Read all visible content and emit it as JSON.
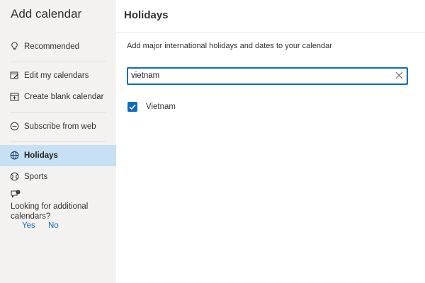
{
  "sidebar": {
    "title": "Add calendar",
    "items": [
      {
        "label": "Recommended",
        "icon": "lightbulb-icon"
      },
      {
        "label": "Edit my calendars",
        "icon": "edit-calendar-icon"
      },
      {
        "label": "Create blank calendar",
        "icon": "add-calendar-icon"
      },
      {
        "label": "Subscribe from web",
        "icon": "link-icon"
      },
      {
        "label": "Holidays",
        "icon": "globe-icon"
      },
      {
        "label": "Sports",
        "icon": "sports-icon"
      }
    ],
    "active_item": "Holidays",
    "feedback": {
      "icon": "feedback-icon",
      "question": "Looking for additional calendars?",
      "yes": "Yes",
      "no": "No"
    }
  },
  "main": {
    "title": "Holidays",
    "description": "Add major international holidays and dates to your calendar",
    "search": {
      "value": "vietnam",
      "clear_icon": "close-icon"
    },
    "results": [
      {
        "label": "Vietnam",
        "checked": true
      }
    ]
  },
  "colors": {
    "accent": "#0f6cbd",
    "sidebar_bg": "#f3f2f1",
    "active_bg": "#c7e0f4"
  }
}
